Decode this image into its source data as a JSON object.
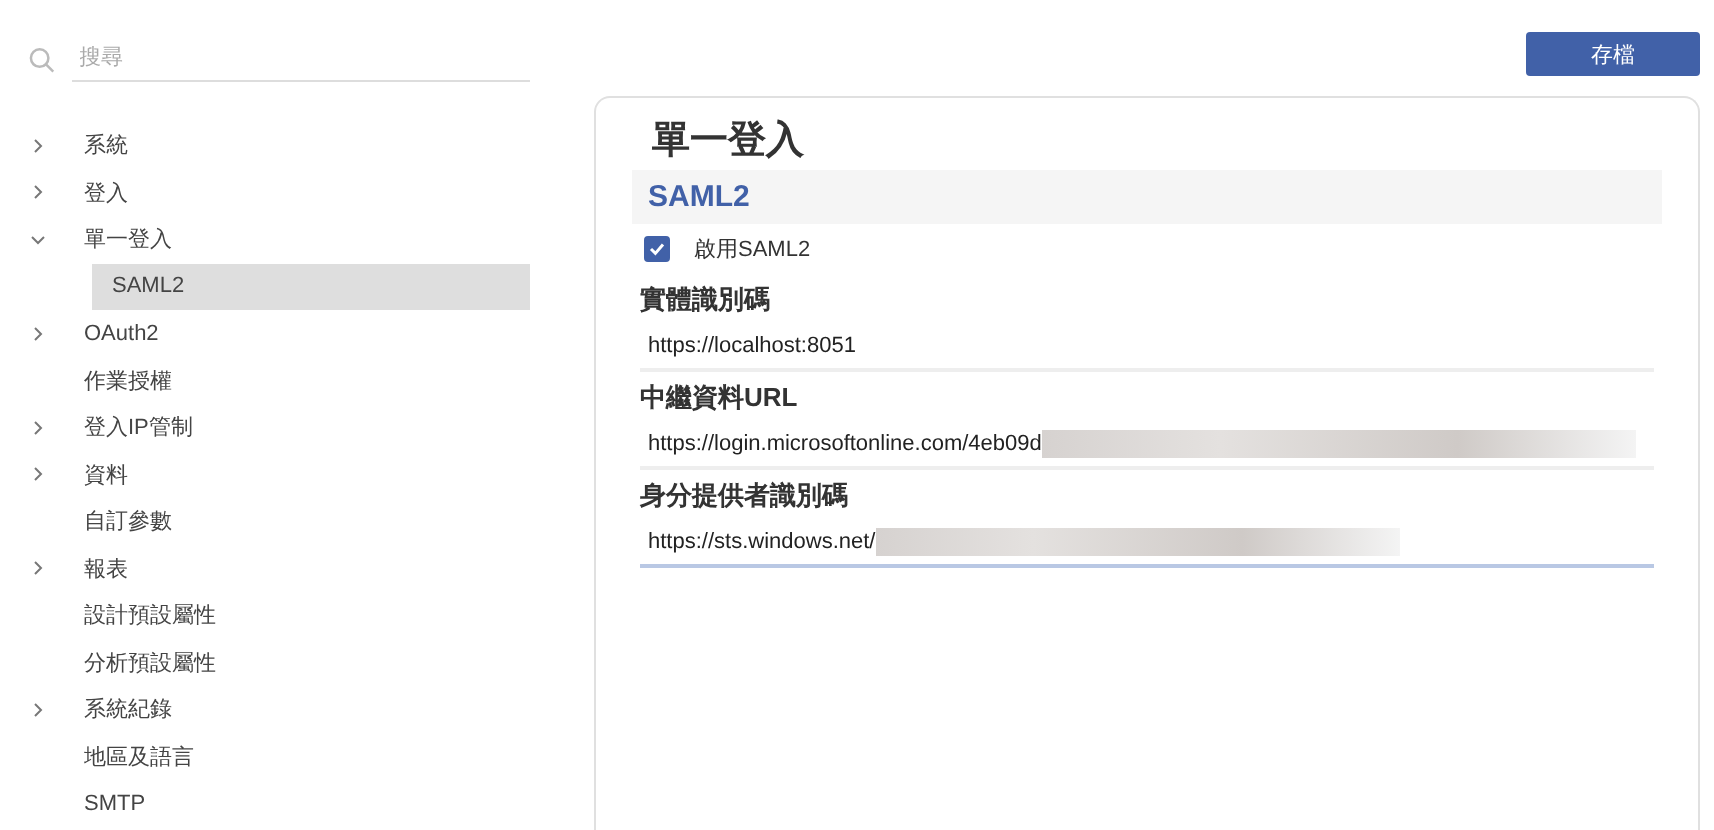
{
  "search": {
    "placeholder": "搜尋"
  },
  "sidebar": {
    "items": [
      {
        "kind": "folder",
        "label": "系統",
        "expanded": false,
        "selected": false
      },
      {
        "kind": "folder",
        "label": "登入",
        "expanded": false,
        "selected": false
      },
      {
        "kind": "folder",
        "label": "單一登入",
        "expanded": true,
        "selected": false,
        "children": [
          {
            "kind": "page",
            "label": "SAML2",
            "selected": true
          }
        ]
      },
      {
        "kind": "folder",
        "label": "OAuth2",
        "expanded": false,
        "selected": false
      },
      {
        "kind": "page",
        "label": "作業授權",
        "selected": false
      },
      {
        "kind": "folder",
        "label": "登入IP管制",
        "expanded": false,
        "selected": false
      },
      {
        "kind": "folder",
        "label": "資料",
        "expanded": false,
        "selected": false
      },
      {
        "kind": "page",
        "label": "自訂參數",
        "selected": false
      },
      {
        "kind": "folder",
        "label": "報表",
        "expanded": false,
        "selected": false
      },
      {
        "kind": "page",
        "label": "設計預設屬性",
        "selected": false
      },
      {
        "kind": "page",
        "label": "分析預設屬性",
        "selected": false
      },
      {
        "kind": "folder",
        "label": "系統紀錄",
        "expanded": false,
        "selected": false
      },
      {
        "kind": "page",
        "label": "地區及語言",
        "selected": false
      },
      {
        "kind": "page",
        "label": "SMTP",
        "selected": false
      }
    ]
  },
  "save_button": "存檔",
  "panel": {
    "title": "單一登入",
    "section": "SAML2",
    "enable": {
      "label": "啟用SAML2",
      "checked": true
    },
    "fields": [
      {
        "label": "實體識別碼",
        "value": "https://localhost:8051",
        "redacted": false,
        "focused": false
      },
      {
        "label": "中繼資料URL",
        "value": "https://login.microsoftonline.com/4eb09d",
        "redacted": true,
        "focused": false
      },
      {
        "label": "身分提供者識別碼",
        "value": "https://sts.windows.net/",
        "redacted": true,
        "focused": true
      }
    ]
  }
}
